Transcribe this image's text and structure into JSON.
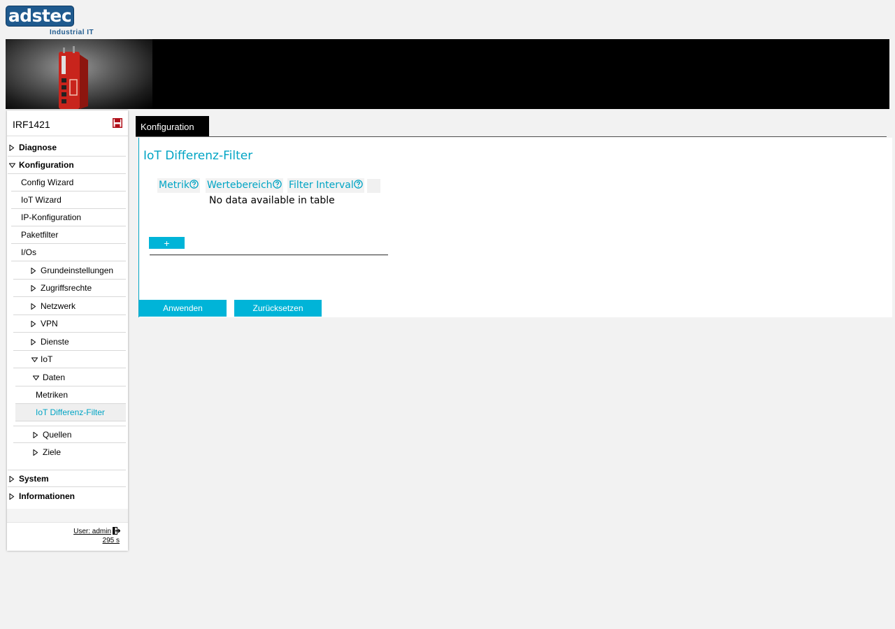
{
  "logo": {
    "brand": "adstec",
    "subtitle": "Industrial IT"
  },
  "sidebar": {
    "device_name": "IRF1421",
    "items": [
      {
        "label": "Diagnose"
      },
      {
        "label": "Konfiguration"
      },
      {
        "label": "Config Wizard"
      },
      {
        "label": "IoT Wizard"
      },
      {
        "label": "IP-Konfiguration"
      },
      {
        "label": "Paketfilter"
      },
      {
        "label": "I/Os"
      },
      {
        "label": "Grundeinstellungen"
      },
      {
        "label": "Zugriffsrechte"
      },
      {
        "label": "Netzwerk"
      },
      {
        "label": "VPN"
      },
      {
        "label": "Dienste"
      },
      {
        "label": "IoT"
      },
      {
        "label": "Daten"
      },
      {
        "label": "Metriken"
      },
      {
        "label": "IoT Differenz-Filter"
      },
      {
        "label": "Quellen"
      },
      {
        "label": "Ziele"
      },
      {
        "label": "System"
      },
      {
        "label": "Informationen"
      }
    ],
    "user_label": "User: admin",
    "session_timer": "295 s"
  },
  "tab": {
    "label": "Konfiguration"
  },
  "main": {
    "title": "IoT Differenz-Filter",
    "table": {
      "columns": [
        "Metrik",
        "Wertebereich",
        "Filter Interval"
      ],
      "empty_message": "No data available in table"
    },
    "add_label": "+",
    "apply_label": "Anwenden",
    "reset_label": "Zurücksetzen"
  },
  "colors": {
    "accent": "#00a4c4",
    "button": "#00b4d8",
    "logo": "#1f5a8e"
  }
}
